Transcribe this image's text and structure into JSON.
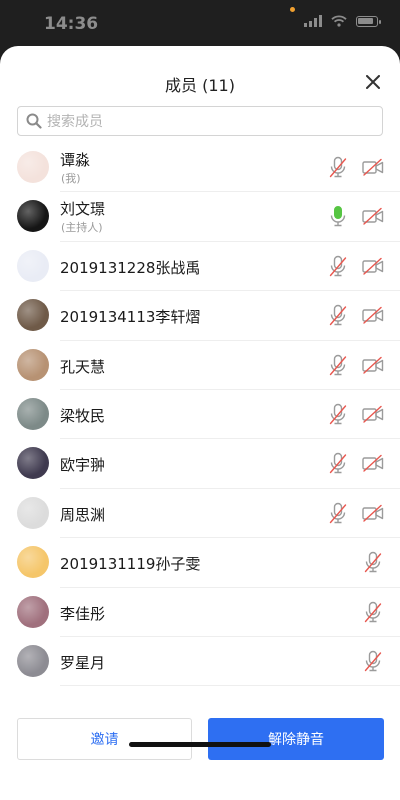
{
  "status_bar": {
    "time": "14:36",
    "dot_color": "#f0a030"
  },
  "header": {
    "title": "成员 (11)"
  },
  "search": {
    "placeholder": "搜索成员"
  },
  "members": [
    {
      "name": "谭淼",
      "sub": "(我)",
      "mic": "muted",
      "camera": "off",
      "avatar": "#f4e2dc"
    },
    {
      "name": "刘文璟",
      "sub": "(主持人)",
      "mic": "active",
      "camera": "off",
      "avatar": "#151515"
    },
    {
      "name": "2019131228张战禹",
      "sub": "",
      "mic": "muted",
      "camera": "off",
      "avatar": "#e9ecf5"
    },
    {
      "name": "2019134113李轩熠",
      "sub": "",
      "mic": "muted",
      "camera": "off",
      "avatar": "#6f5a48"
    },
    {
      "name": "孔天慧",
      "sub": "",
      "mic": "muted",
      "camera": "off",
      "avatar": "#b79273"
    },
    {
      "name": "梁牧民",
      "sub": "",
      "mic": "muted",
      "camera": "off",
      "avatar": "#7d8a88"
    },
    {
      "name": "欧宇翀",
      "sub": "",
      "mic": "muted",
      "camera": "off",
      "avatar": "#3f3a4f"
    },
    {
      "name": "周思渊",
      "sub": "",
      "mic": "muted",
      "camera": "off",
      "avatar": "#dcdcdc"
    },
    {
      "name": "2019131119孙子雯",
      "sub": "",
      "mic": "muted",
      "camera": "none",
      "avatar": "#f5c66a"
    },
    {
      "name": "李佳彤",
      "sub": "",
      "mic": "muted",
      "camera": "none",
      "avatar": "#a0707d"
    },
    {
      "name": "罗星月",
      "sub": "",
      "mic": "muted",
      "camera": "none",
      "avatar": "#8d8c93"
    }
  ],
  "footer": {
    "invite_label": "邀请",
    "unmute_label": "解除静音"
  },
  "colors": {
    "accent": "#2e6ff2",
    "mic_active": "#56c543",
    "mic_muted_line": "#e8574f",
    "icon_gray": "#9b9b9b"
  }
}
